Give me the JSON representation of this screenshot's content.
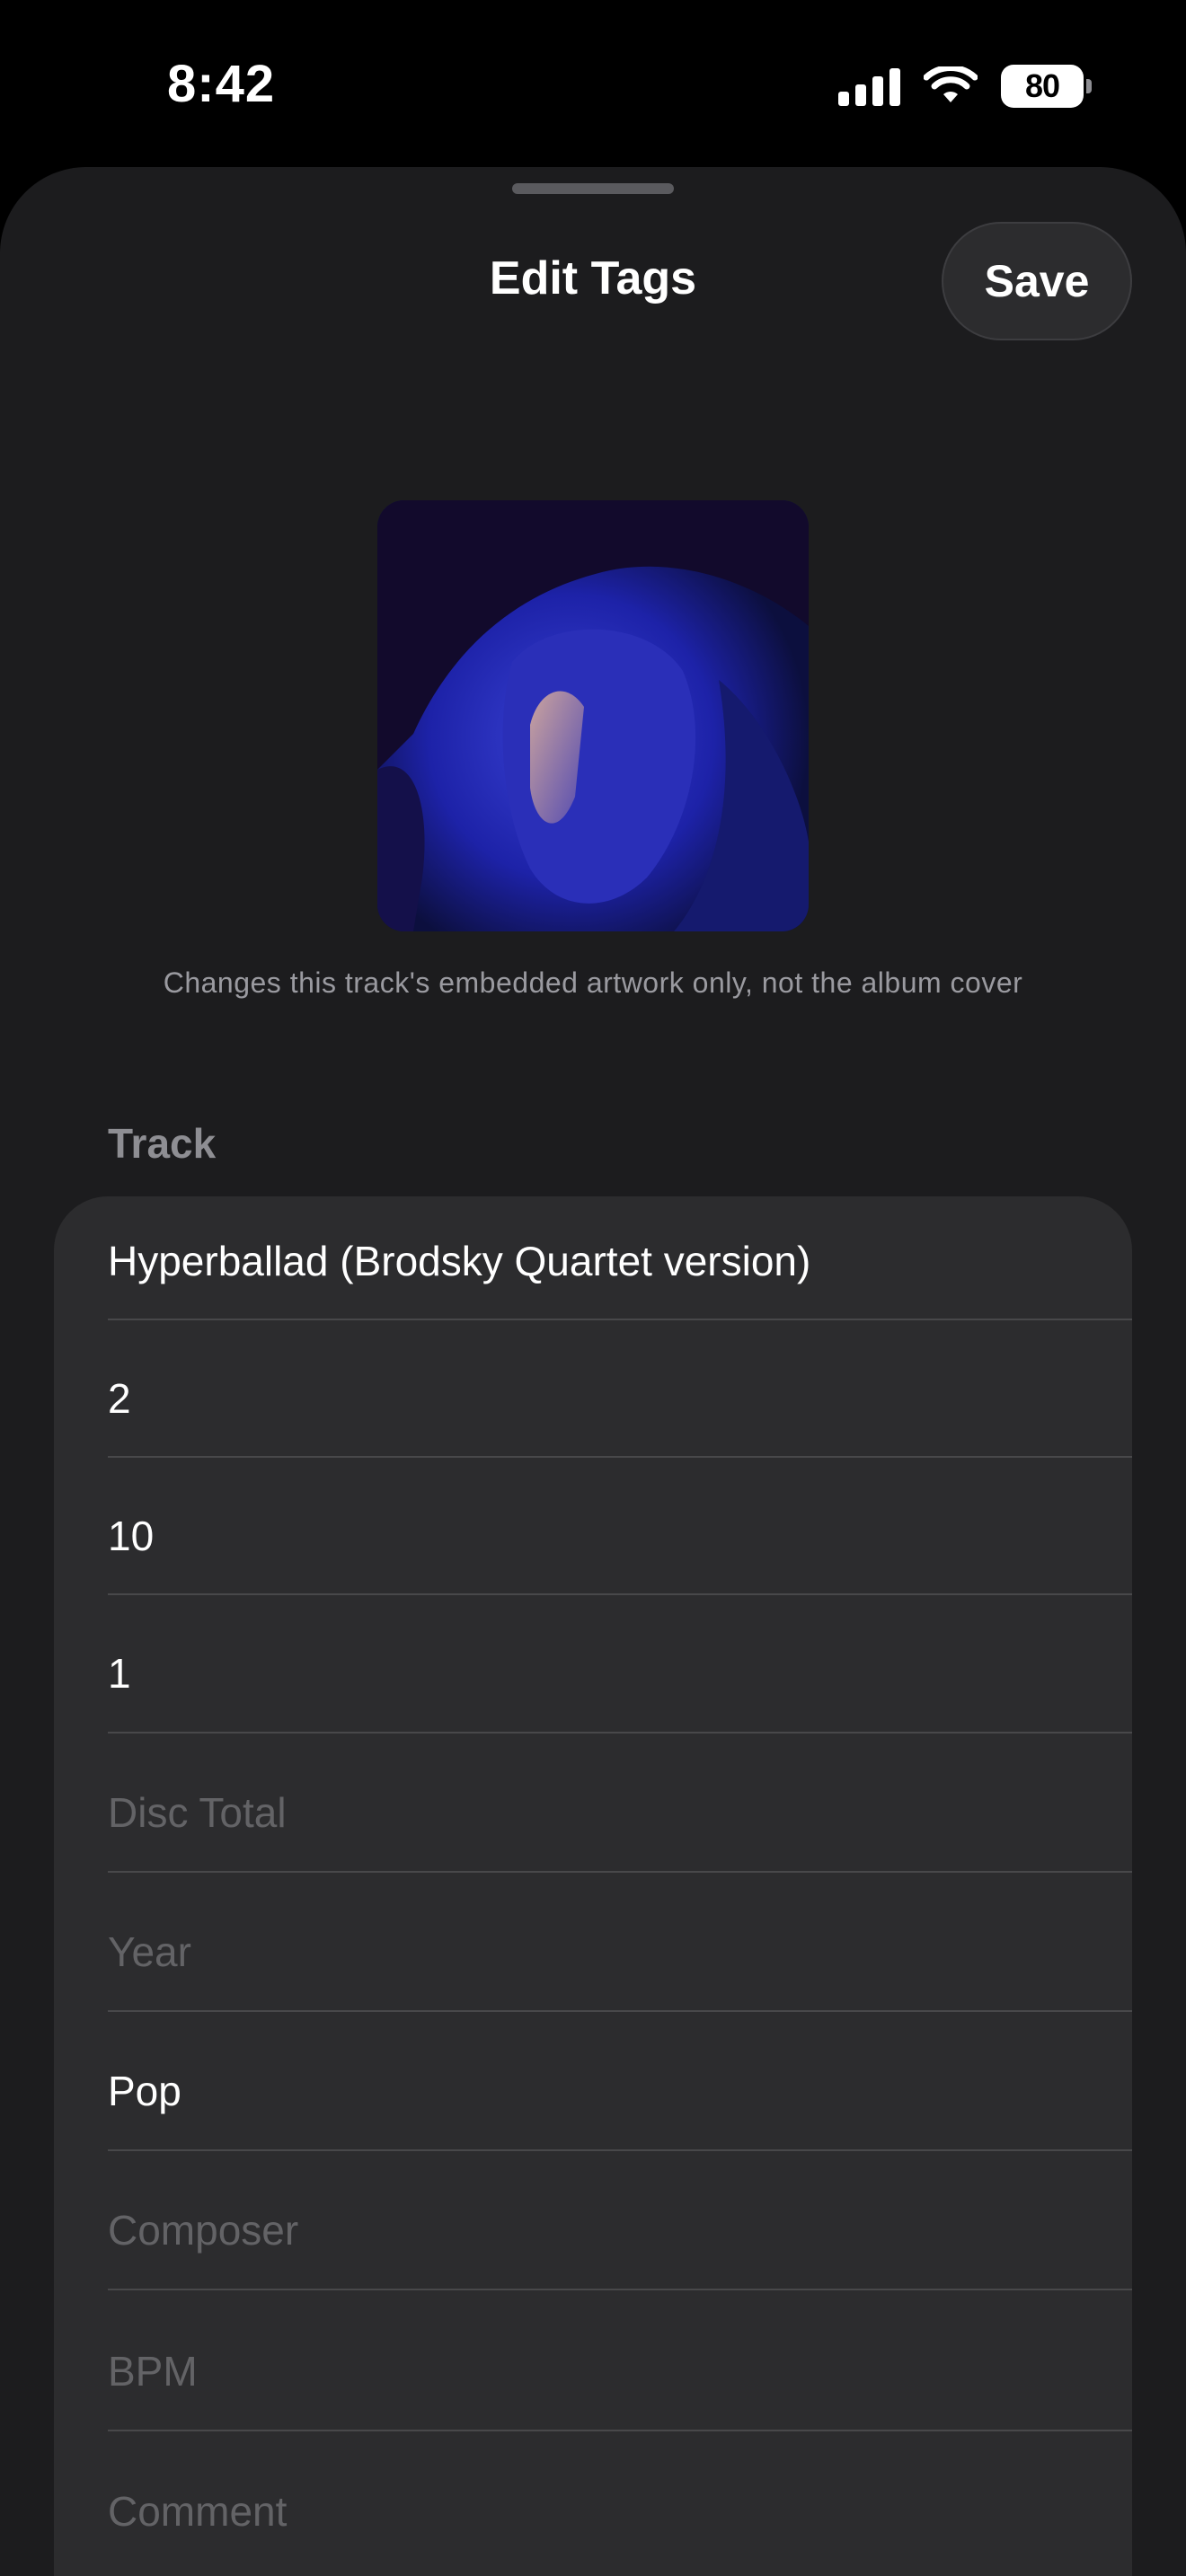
{
  "status_bar": {
    "time": "8:42",
    "battery": "80",
    "icons": [
      "cellular-signal-icon",
      "wifi-icon",
      "battery-icon"
    ]
  },
  "sheet": {
    "title": "Edit Tags",
    "save_label": "Save"
  },
  "artwork": {
    "caption": "Changes this track's embedded artwork only, not the album cover",
    "tint": "#1d22a8"
  },
  "section": {
    "title": "Track"
  },
  "fields": [
    {
      "name": "title",
      "value": "Hyperballad (Brodsky Quartet version)",
      "placeholder": ""
    },
    {
      "name": "track-number",
      "value": "2",
      "placeholder": ""
    },
    {
      "name": "track-total",
      "value": "10",
      "placeholder": ""
    },
    {
      "name": "disc-number",
      "value": "1",
      "placeholder": ""
    },
    {
      "name": "disc-total",
      "value": "",
      "placeholder": "Disc Total"
    },
    {
      "name": "year",
      "value": "",
      "placeholder": "Year"
    },
    {
      "name": "genre",
      "value": "Pop",
      "placeholder": ""
    },
    {
      "name": "composer",
      "value": "",
      "placeholder": "Composer"
    },
    {
      "name": "bpm",
      "value": "",
      "placeholder": "BPM"
    },
    {
      "name": "comment",
      "value": "",
      "placeholder": "Comment"
    }
  ],
  "colors": {
    "background": "#000000",
    "sheet": "#1c1c1e",
    "card": "#2c2c2e",
    "secondary_text": "#8e8e93",
    "placeholder_text": "#636366"
  }
}
